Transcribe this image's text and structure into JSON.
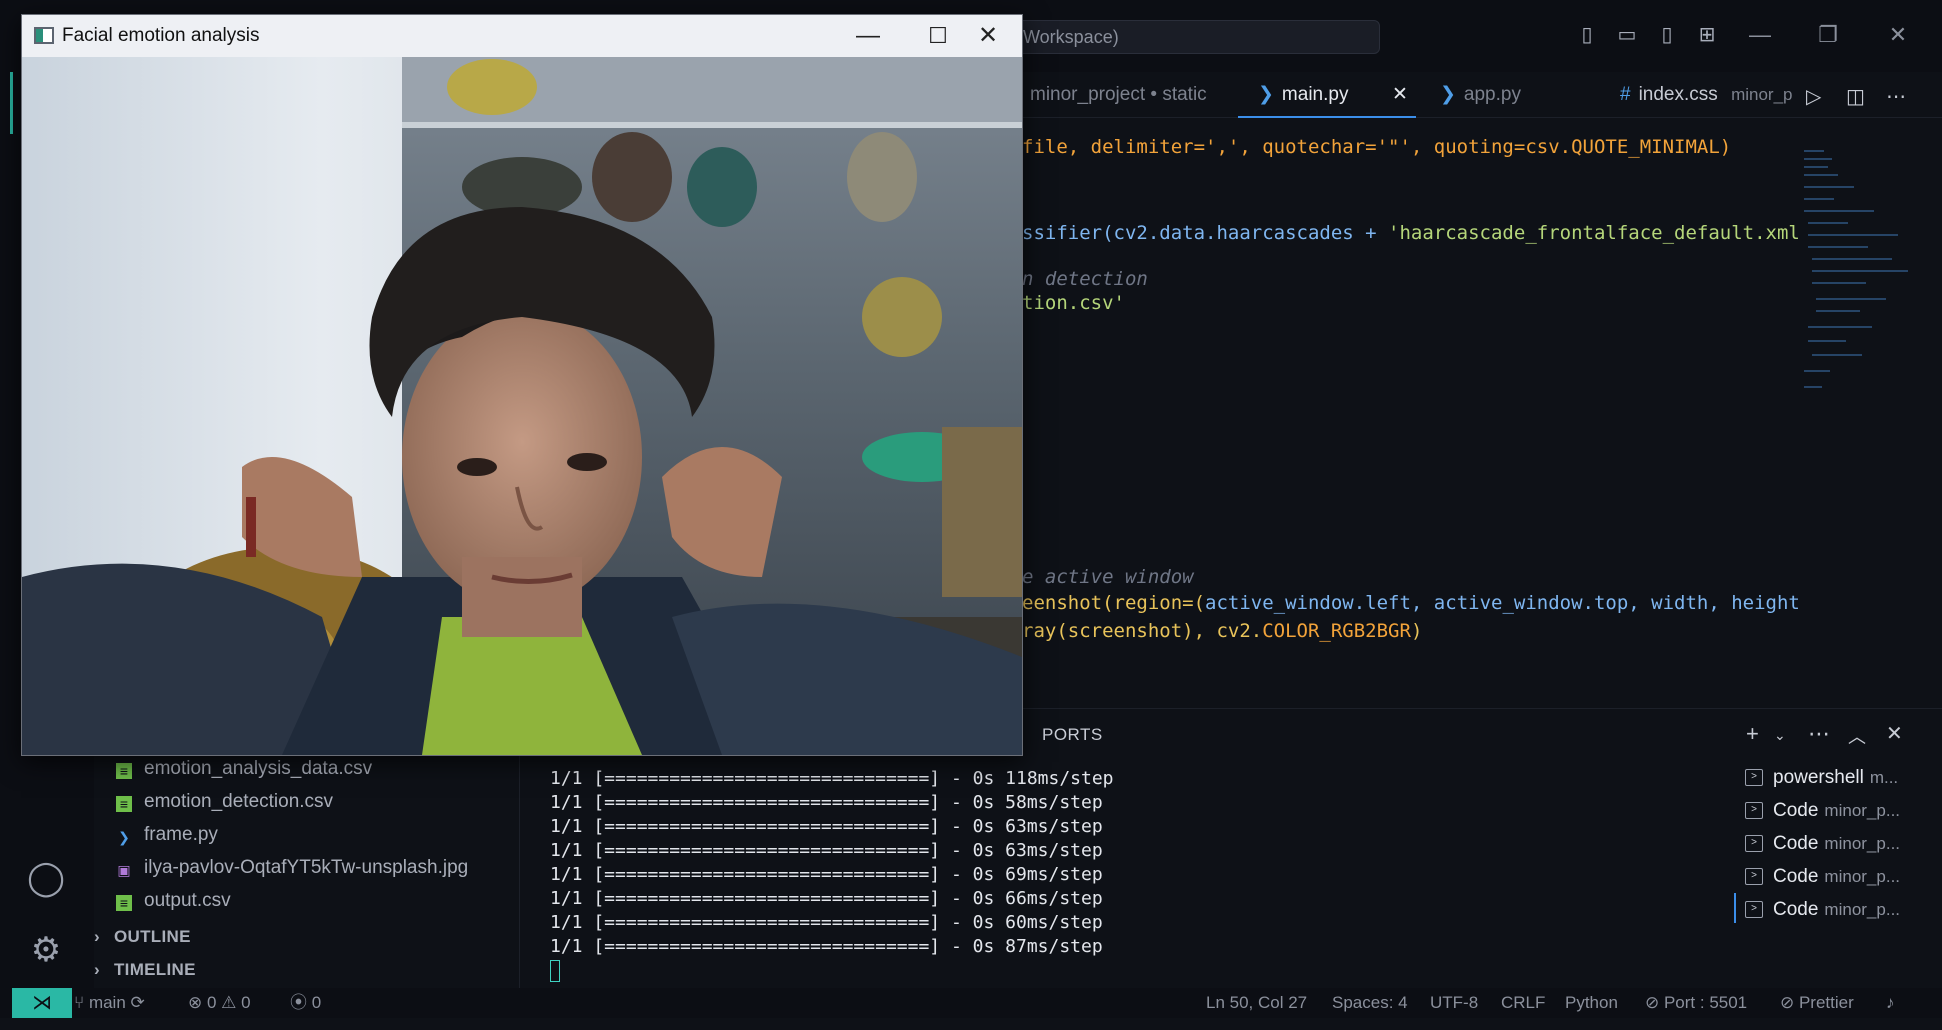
{
  "vscode": {
    "command_center": "Workspace)",
    "tabs": [
      {
        "label": "minor_project • static"
      },
      {
        "label": "main.py",
        "close": "✕"
      },
      {
        "label": "app.py"
      },
      {
        "label": "index.css",
        "sub": "minor_p"
      }
    ],
    "tab_icon_hash": "#",
    "editor_lines": {
      "l1": "file, delimiter=',', quotechar='\"', quoting=csv.QUOTE_MINIMAL)",
      "l2_a": "ssifier(cv2.data.haarcascades + ",
      "l2_b": "'haarcascade_frontalface_default.xml",
      "l3": "n detection",
      "l4": "tion.csv'",
      "l5": "e active window",
      "l6_a": "eenshot(region=(",
      "l6_b": "active_window.left, active_window.top, width, height",
      "l7_a": "ray(screenshot), cv2.",
      "l7_b": "COLOR_RGB2BGR",
      "l7_c": ")"
    },
    "panel": {
      "ports_label": "PORTS",
      "terminal_lines": [
        "1/1 [==============================] - 0s 118ms/step",
        "1/1 [==============================] - 0s 58ms/step",
        "1/1 [==============================] - 0s 63ms/step",
        "1/1 [==============================] - 0s 63ms/step",
        "1/1 [==============================] - 0s 69ms/step",
        "1/1 [==============================] - 0s 66ms/step",
        "1/1 [==============================] - 0s 60ms/step",
        "1/1 [==============================] - 0s 87ms/step"
      ],
      "terminals": [
        {
          "name": "powershell",
          "sub": "m..."
        },
        {
          "name": "Code",
          "sub": "minor_p..."
        },
        {
          "name": "Code",
          "sub": "minor_p..."
        },
        {
          "name": "Code",
          "sub": "minor_p..."
        },
        {
          "name": "Code",
          "sub": "minor_p..."
        }
      ]
    },
    "explorer": {
      "files": [
        {
          "name": "emotion_analysis_data.csv",
          "type": "csv"
        },
        {
          "name": "emotion_detection.csv",
          "type": "csv"
        },
        {
          "name": "frame.py",
          "type": "py"
        },
        {
          "name": "ilya-pavlov-OqtafYT5kTw-unsplash.jpg",
          "type": "img"
        },
        {
          "name": "output.csv",
          "type": "csv"
        }
      ],
      "sections": [
        "OUTLINE",
        "TIMELINE"
      ]
    },
    "statusbar": {
      "branch": "main",
      "errors": "0",
      "warnings": "0",
      "ports": "0",
      "position": "Ln 50, Col 27",
      "spaces": "Spaces: 4",
      "encoding": "UTF-8",
      "eol": "CRLF",
      "language": "Python",
      "port": "Port : 5501",
      "prettier": "Prettier"
    }
  },
  "camera_window": {
    "title": "Facial emotion analysis",
    "controls": {
      "minimize": "—",
      "maximize": "☐",
      "close": "✕"
    }
  },
  "colors": {
    "accent": "#3b8eea",
    "remote": "#2ab8a5",
    "terminal_cursor": "#3fd2c2"
  }
}
